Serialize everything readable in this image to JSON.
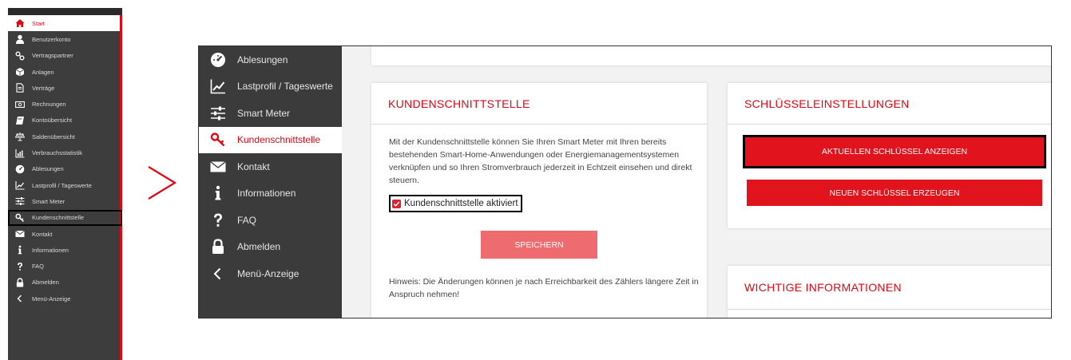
{
  "mini_sidebar": {
    "items": [
      {
        "label": "Start",
        "icon": "home-icon"
      },
      {
        "label": "Benutzerkonto",
        "icon": "user-icon"
      },
      {
        "label": "Vertragspartner",
        "icon": "link-icon"
      },
      {
        "label": "Anlagen",
        "icon": "cube-icon"
      },
      {
        "label": "Verträge",
        "icon": "document-icon"
      },
      {
        "label": "Rechnungen",
        "icon": "banknote-icon"
      },
      {
        "label": "Kontoübersicht",
        "icon": "book-icon"
      },
      {
        "label": "Saldenübersicht",
        "icon": "scale-icon"
      },
      {
        "label": "Verbrauchsstatistik",
        "icon": "bar-chart-icon"
      },
      {
        "label": "Ablesungen",
        "icon": "gauge-icon"
      },
      {
        "label": "Lastprofil / Tageswerte",
        "icon": "line-chart-icon"
      },
      {
        "label": "Smart Meter",
        "icon": "sliders-icon"
      },
      {
        "label": "Kundenschnittstelle",
        "icon": "key-icon"
      },
      {
        "label": "Kontakt",
        "icon": "envelope-icon"
      },
      {
        "label": "Informationen",
        "icon": "info-icon"
      },
      {
        "label": "FAQ",
        "icon": "question-icon"
      },
      {
        "label": "Abmelden",
        "icon": "lock-icon"
      },
      {
        "label": "Menü-Anzeige",
        "icon": "chevron-left-icon"
      }
    ]
  },
  "sidebar": {
    "items": [
      {
        "label": "Ablesungen",
        "icon": "gauge-icon"
      },
      {
        "label": "Lastprofil / Tageswerte",
        "icon": "line-chart-icon"
      },
      {
        "label": "Smart Meter",
        "icon": "sliders-icon"
      },
      {
        "label": "Kundenschnittstelle",
        "icon": "key-icon"
      },
      {
        "label": "Kontakt",
        "icon": "envelope-icon"
      },
      {
        "label": "Informationen",
        "icon": "info-icon"
      },
      {
        "label": "FAQ",
        "icon": "question-icon"
      },
      {
        "label": "Abmelden",
        "icon": "lock-icon"
      },
      {
        "label": "Menü-Anzeige",
        "icon": "chevron-left-icon"
      }
    ]
  },
  "kundenschnittstelle": {
    "title": "KUNDENSCHNITTSTELLE",
    "description": "Mit der Kundenschnittstelle können Sie Ihren Smart Meter mit Ihren bereits bestehenden Smart-Home-Anwendungen oder Energiemanagementsystemen verknüpfen und so Ihren Stromverbrauch jederzeit in Echtzeit einsehen und direkt steuern.",
    "checkbox_label": "Kundenschnittstelle aktiviert",
    "checkbox_checked": true,
    "save_label": "SPEICHERN",
    "hint": "Hinweis: Die Änderungen können je nach Erreichbarkeit des Zählers längere Zeit in Anspruch nehmen!"
  },
  "schluessel": {
    "title": "SCHLÜSSELEINSTELLUNGEN",
    "show_key_label": "AKTUELLEN SCHLÜSSEL ANZEIGEN",
    "new_key_label": "NEUEN SCHLÜSSEL ERZEUGEN"
  },
  "wichtige": {
    "title": "WICHTIGE INFORMATIONEN"
  },
  "colors": {
    "accent": "#e30613",
    "sidebar_bg": "#3b3b3b",
    "save_button": "#ee6b6f"
  }
}
